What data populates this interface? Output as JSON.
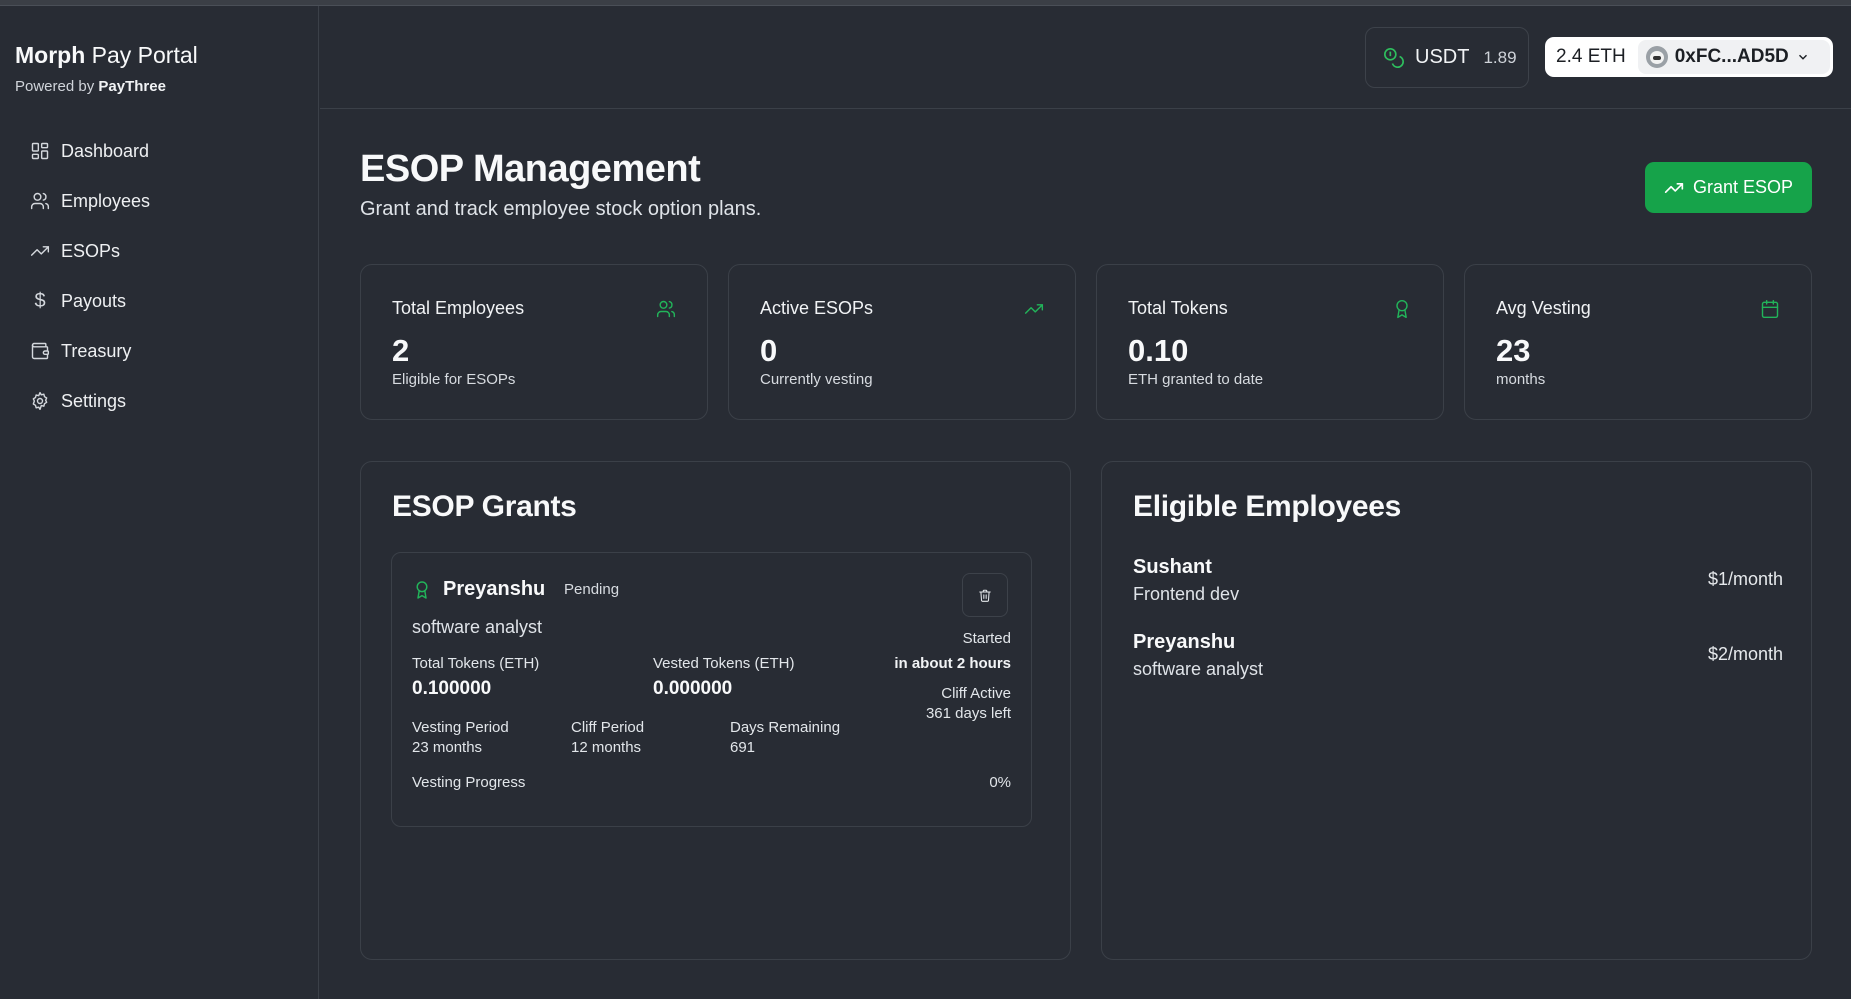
{
  "brand": {
    "name_bold": "Morph",
    "name_rest": " Pay Portal",
    "powered_prefix": "Powered by ",
    "powered_name": "PayThree"
  },
  "sidebar": {
    "items": [
      {
        "label": "Dashboard",
        "icon": "dashboard-icon"
      },
      {
        "label": "Employees",
        "icon": "users-icon"
      },
      {
        "label": "ESOPs",
        "icon": "trending-up-icon"
      },
      {
        "label": "Payouts",
        "icon": "dollar-icon"
      },
      {
        "label": "Treasury",
        "icon": "wallet-icon"
      },
      {
        "label": "Settings",
        "icon": "gear-icon"
      }
    ]
  },
  "header": {
    "token_label": "USDT",
    "token_balance": "1.89",
    "eth_balance": "2.4 ETH",
    "wallet_address": "0xFC...AD5D"
  },
  "page": {
    "title": "ESOP Management",
    "subtitle": "Grant and track employee stock option plans.",
    "grant_button": "Grant ESOP"
  },
  "stats": [
    {
      "label": "Total Employees",
      "value": "2",
      "desc": "Eligible for ESOPs",
      "icon": "users-icon"
    },
    {
      "label": "Active ESOPs",
      "value": "0",
      "desc": "Currently vesting",
      "icon": "trending-up-icon"
    },
    {
      "label": "Total Tokens",
      "value": "0.10",
      "desc": "ETH granted to date",
      "icon": "award-icon"
    },
    {
      "label": "Avg Vesting",
      "value": "23",
      "desc": "months",
      "icon": "calendar-icon"
    }
  ],
  "grants": {
    "title": "ESOP Grants",
    "items": [
      {
        "name": "Preyanshu",
        "status": "Pending",
        "role": "software analyst",
        "start_label": "Started",
        "start_value": "in about 2 hours",
        "cliff_label": "Cliff Active",
        "cliff_value": "361 days left",
        "total_tokens_label": "Total Tokens (ETH)",
        "total_tokens": "0.100000",
        "vested_tokens_label": "Vested Tokens (ETH)",
        "vested_tokens": "0.000000",
        "vesting_period_label": "Vesting Period",
        "vesting_period": "23 months",
        "cliff_period_label": "Cliff Period",
        "cliff_period": "12 months",
        "days_remaining_label": "Days Remaining",
        "days_remaining": "691",
        "progress_label": "Vesting Progress",
        "progress": "0%"
      }
    ]
  },
  "eligible": {
    "title": "Eligible Employees",
    "items": [
      {
        "name": "Sushant",
        "role": "Frontend dev",
        "rate": "$1/month"
      },
      {
        "name": "Preyanshu",
        "role": "software analyst",
        "rate": "$2/month"
      }
    ]
  },
  "colors": {
    "accent": "#16a34a",
    "icon_green": "#22b45a",
    "background": "#282c34",
    "border": "#3b4048"
  }
}
